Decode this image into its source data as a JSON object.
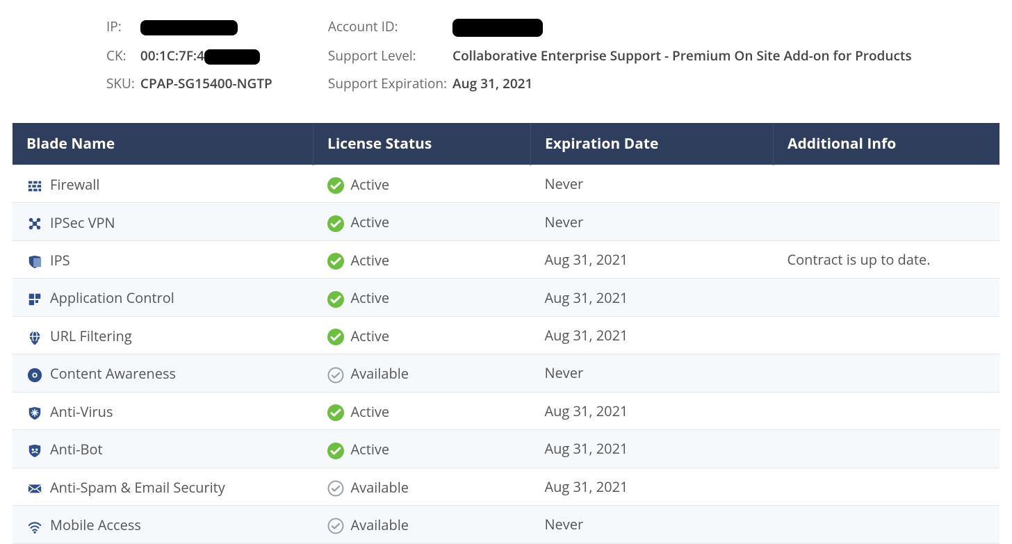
{
  "info": {
    "ip_label": "IP:",
    "ip_value": "",
    "ck_label": "CK:",
    "ck_value": "00:1C:7F:4",
    "sku_label": "SKU:",
    "sku_value": "CPAP-SG15400-NGTP",
    "account_label": "Account ID:",
    "account_value": "",
    "support_level_label": "Support Level:",
    "support_level_value": "Collaborative Enterprise Support - Premium On Site Add-on for Products",
    "support_exp_label": "Support Expiration:",
    "support_exp_value": "Aug 31, 2021"
  },
  "columns": {
    "name": "Blade Name",
    "license": "License Status",
    "expiration": "Expiration Date",
    "info": "Additional Info"
  },
  "status_labels": {
    "active": "Active",
    "available": "Available"
  },
  "blades": [
    {
      "icon": "firewall-icon",
      "name": "Firewall",
      "status": "active",
      "expiration": "Never",
      "info": ""
    },
    {
      "icon": "ipsec-vpn-icon",
      "name": "IPSec VPN",
      "status": "active",
      "expiration": "Never",
      "info": ""
    },
    {
      "icon": "ips-icon",
      "name": "IPS",
      "status": "active",
      "expiration": "Aug 31, 2021",
      "info": "Contract is up to date."
    },
    {
      "icon": "app-control-icon",
      "name": "Application Control",
      "status": "active",
      "expiration": "Aug 31, 2021",
      "info": ""
    },
    {
      "icon": "url-filtering-icon",
      "name": "URL Filtering",
      "status": "active",
      "expiration": "Aug 31, 2021",
      "info": ""
    },
    {
      "icon": "content-awareness-icon",
      "name": "Content Awareness",
      "status": "available",
      "expiration": "Never",
      "info": ""
    },
    {
      "icon": "anti-virus-icon",
      "name": "Anti-Virus",
      "status": "active",
      "expiration": "Aug 31, 2021",
      "info": ""
    },
    {
      "icon": "anti-bot-icon",
      "name": "Anti-Bot",
      "status": "active",
      "expiration": "Aug 31, 2021",
      "info": ""
    },
    {
      "icon": "anti-spam-icon",
      "name": "Anti-Spam & Email Security",
      "status": "available",
      "expiration": "Aug 31, 2021",
      "info": ""
    },
    {
      "icon": "mobile-access-icon",
      "name": "Mobile Access",
      "status": "available",
      "expiration": "Never",
      "info": ""
    }
  ]
}
